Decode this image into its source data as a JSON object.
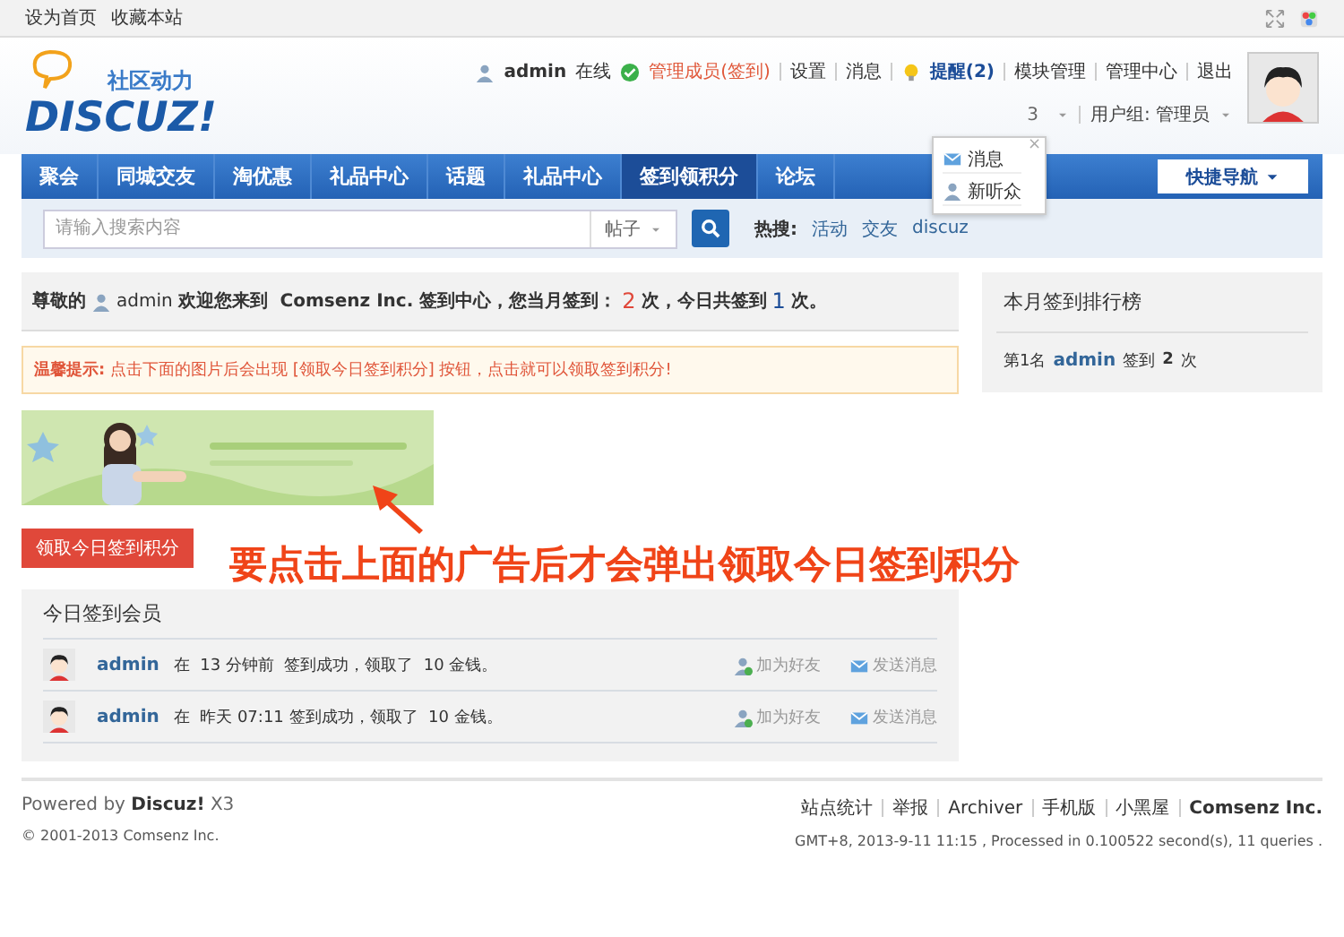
{
  "top_bar": {
    "links": [
      "设为首页",
      "收藏本站"
    ]
  },
  "logo": {
    "tagline": "社区动力",
    "wordmark": "DISCUZ!"
  },
  "user_bar": {
    "username": "admin",
    "status": "在线",
    "role_link": "管理成员(签到)",
    "links": [
      "设置",
      "消息"
    ],
    "notice": "提醒(2)",
    "links2": [
      "模块管理",
      "管理中心",
      "退出"
    ],
    "hidden_stat": "3",
    "group": "用户组: 管理员"
  },
  "notice_popup": {
    "close": "×",
    "items": [
      {
        "kind": "mail",
        "label": "消息"
      },
      {
        "kind": "user",
        "label": "新听众"
      }
    ]
  },
  "nav": {
    "items": [
      {
        "label": "聚会",
        "selected": false
      },
      {
        "label": "同城交友",
        "selected": false
      },
      {
        "label": "淘优惠",
        "selected": false
      },
      {
        "label": "礼品中心",
        "selected": false
      },
      {
        "label": "话题",
        "selected": false
      },
      {
        "label": "礼品中心",
        "selected": false
      },
      {
        "label": "签到领积分",
        "selected": true
      },
      {
        "label": "论坛",
        "selected": false
      }
    ],
    "quick_nav": "快捷导航"
  },
  "search": {
    "placeholder": "请输入搜索内容",
    "scope": "帖子",
    "hot_label": "热搜:",
    "hot": [
      "活动",
      "交友",
      "discuz"
    ]
  },
  "welcome": {
    "prefix": "尊敬的",
    "username": "admin",
    "middle": "欢迎您来到  Comsenz Inc. 签到中心，您当月签到：",
    "month_count": "2",
    "mid2": "次，今日共签到",
    "today_count": "1",
    "suffix": "次。"
  },
  "tip": {
    "label": "温馨提示:",
    "text": "点击下面的图片后会出现 [领取今日签到积分] 按钮，点击就可以领取签到积分!"
  },
  "claim_button": "领取今日签到积分",
  "annotation": "要点击上面的广告后才会弹出领取今日签到积分",
  "members": {
    "title": "今日签到会员",
    "rows": [
      {
        "username": "admin",
        "text": "在  13 分钟前  签到成功，领取了  10 金钱。",
        "add_friend": "加为好友",
        "send_message": "发送消息"
      },
      {
        "username": "admin",
        "text": "在  昨天 07:11 签到成功，领取了  10 金钱。",
        "add_friend": "加为好友",
        "send_message": "发送消息"
      }
    ]
  },
  "ranking": {
    "title": "本月签到排行榜",
    "rows": [
      {
        "rank": "第1名",
        "username": "admin",
        "label": "签到",
        "count": "2",
        "unit": "次"
      }
    ]
  },
  "footer": {
    "powered_prefix": "Powered by",
    "brand": "Discuz!",
    "version": "X3",
    "copyright": "© 2001-2013 Comsenz Inc.",
    "links": [
      "站点统计",
      "举报",
      "Archiver",
      "手机版",
      "小黑屋"
    ],
    "company": "Comsenz Inc.",
    "stats": "GMT+8, 2013-9-11 11:15 , Processed in 0.100522 second(s), 11 queries ."
  }
}
